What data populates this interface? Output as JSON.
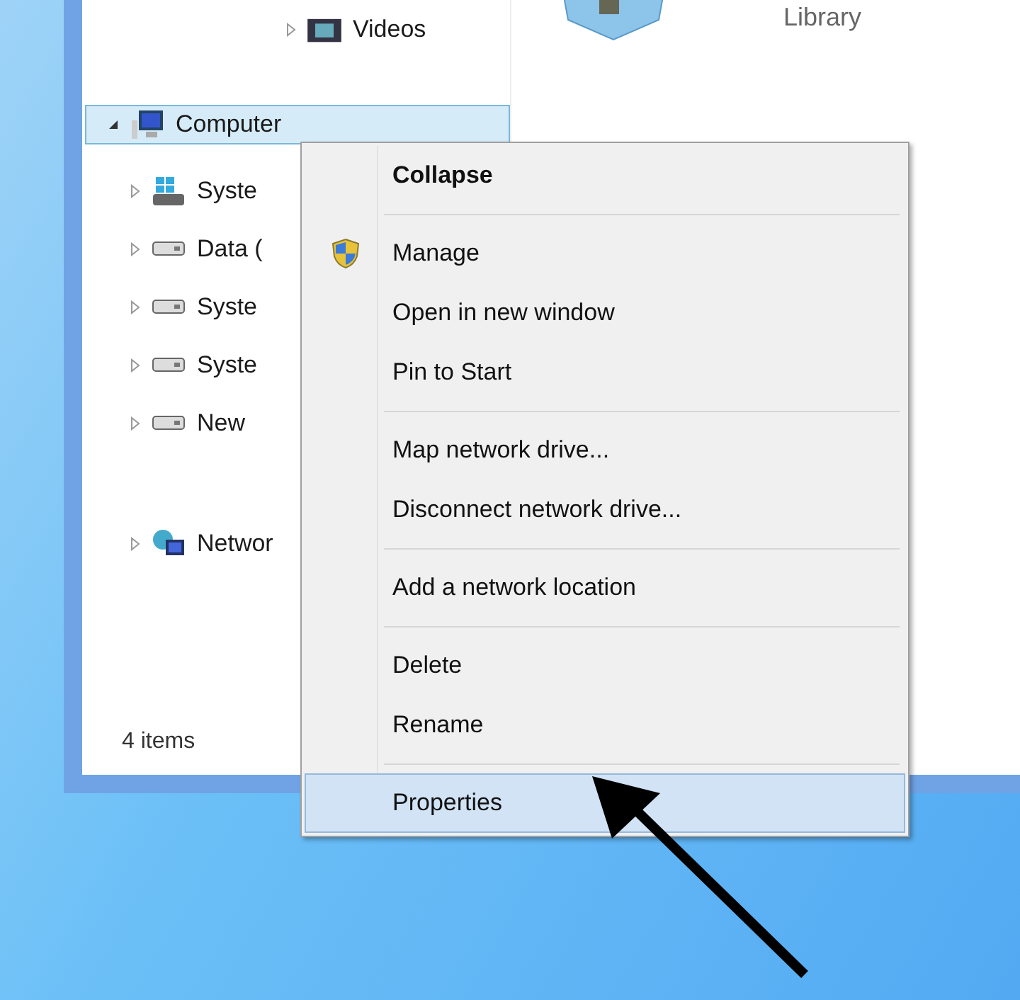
{
  "navigation_pane": {
    "items": [
      {
        "label": "Videos",
        "kind": "videos",
        "expanded": false,
        "selected": false
      },
      {
        "label": "Computer",
        "kind": "computer",
        "expanded": true,
        "selected": true,
        "children": [
          {
            "label": "Syste",
            "kind": "system-drive",
            "expanded": false,
            "selected": false
          },
          {
            "label": "Data (",
            "kind": "drive",
            "expanded": false,
            "selected": false
          },
          {
            "label": "Syste",
            "kind": "drive",
            "expanded": false,
            "selected": false
          },
          {
            "label": "Syste",
            "kind": "drive",
            "expanded": false,
            "selected": false
          },
          {
            "label": "New",
            "kind": "drive",
            "expanded": false,
            "selected": false
          }
        ]
      },
      {
        "label": "Networ",
        "kind": "network",
        "expanded": false,
        "selected": false
      }
    ]
  },
  "content_pane": {
    "items": [
      {
        "label": "Library"
      }
    ]
  },
  "status_bar": {
    "text": "4 items"
  },
  "context_menu": {
    "groups": [
      [
        {
          "label": "Collapse",
          "default": true,
          "shield": false,
          "selected": false
        }
      ],
      [
        {
          "label": "Manage",
          "default": false,
          "shield": true,
          "selected": false
        },
        {
          "label": "Open in new window",
          "default": false,
          "shield": false,
          "selected": false
        },
        {
          "label": "Pin to Start",
          "default": false,
          "shield": false,
          "selected": false
        }
      ],
      [
        {
          "label": "Map network drive...",
          "default": false,
          "shield": false,
          "selected": false
        },
        {
          "label": "Disconnect network drive...",
          "default": false,
          "shield": false,
          "selected": false
        }
      ],
      [
        {
          "label": "Add a network location",
          "default": false,
          "shield": false,
          "selected": false
        }
      ],
      [
        {
          "label": "Delete",
          "default": false,
          "shield": false,
          "selected": false
        },
        {
          "label": "Rename",
          "default": false,
          "shield": false,
          "selected": false
        }
      ],
      [
        {
          "label": "Properties",
          "default": false,
          "shield": false,
          "selected": true
        }
      ]
    ]
  }
}
